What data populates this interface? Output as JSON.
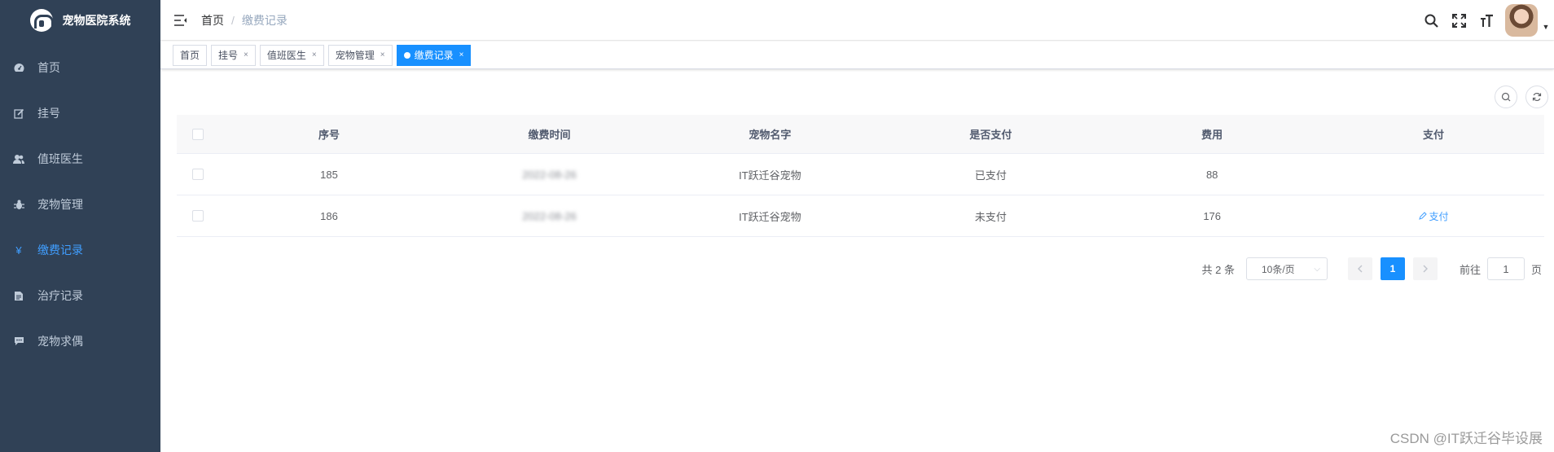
{
  "app": {
    "title": "宠物医院系统"
  },
  "sidebar": {
    "items": [
      {
        "label": "首页",
        "icon": "dashboard-icon"
      },
      {
        "label": "挂号",
        "icon": "edit-icon"
      },
      {
        "label": "值班医生",
        "icon": "peoples-icon"
      },
      {
        "label": "宠物管理",
        "icon": "bug-icon"
      },
      {
        "label": "缴费记录",
        "icon": "yen-icon",
        "active": true
      },
      {
        "label": "治疗记录",
        "icon": "documentation-icon"
      },
      {
        "label": "宠物求偶",
        "icon": "message-icon"
      }
    ]
  },
  "breadcrumb": {
    "home": "首页",
    "separator": "/",
    "current": "缴费记录"
  },
  "tags": [
    {
      "label": "首页",
      "closable": false
    },
    {
      "label": "挂号",
      "closable": true
    },
    {
      "label": "值班医生",
      "closable": true
    },
    {
      "label": "宠物管理",
      "closable": true
    },
    {
      "label": "缴费记录",
      "closable": true,
      "active": true
    }
  ],
  "tag_close": "×",
  "table": {
    "headers": [
      "序号",
      "缴费时间",
      "宠物名字",
      "是否支付",
      "费用",
      "支付"
    ],
    "rows": [
      {
        "id": "185",
        "time": "2022-08-26",
        "pet": "IT跃迁谷宠物",
        "paid": "已支付",
        "fee": "88",
        "action": ""
      },
      {
        "id": "186",
        "time": "2022-08-26",
        "pet": "IT跃迁谷宠物",
        "paid": "未支付",
        "fee": "176",
        "action": "支付"
      }
    ]
  },
  "pagination": {
    "total_text": "共 2 条",
    "page_size": "10条/页",
    "current_page": "1",
    "goto_label": "前往",
    "goto_value": "1",
    "page_suffix": "页"
  },
  "watermark": "CSDN @IT跃迁谷毕设展",
  "colors": {
    "sidebar_bg": "#304156",
    "accent": "#1890ff",
    "menu_active": "#409eff"
  }
}
